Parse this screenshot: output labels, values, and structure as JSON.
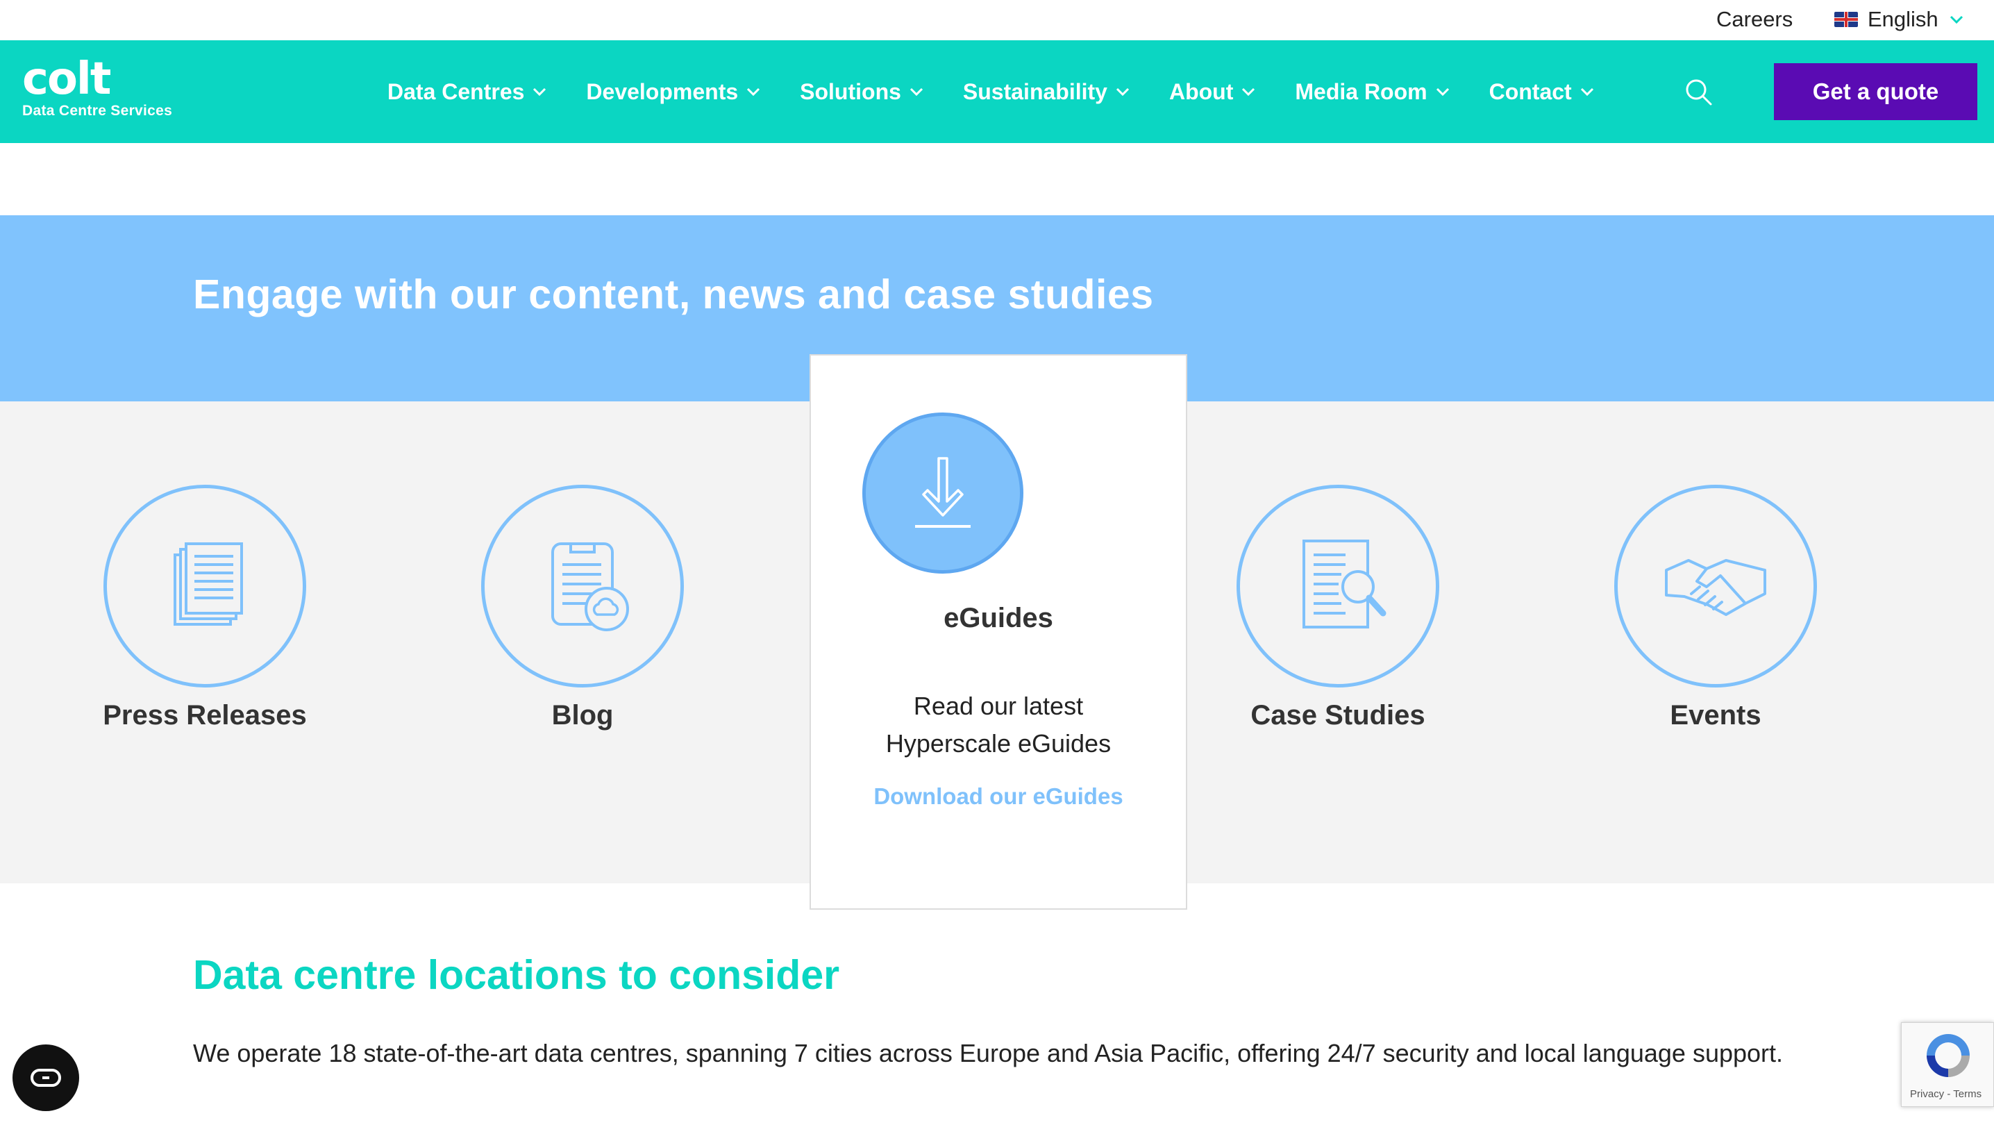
{
  "topbar": {
    "careers": "Careers",
    "language": "English",
    "flag_icon": "uk-flag-icon"
  },
  "brand": {
    "logo_word": "colt",
    "logo_sub": "Data Centre Services",
    "teal": "#0bd6c2",
    "purple": "#5a0bb3",
    "light_blue": "#80c3fd"
  },
  "nav": {
    "items": [
      {
        "label": "Data Centres"
      },
      {
        "label": "Developments"
      },
      {
        "label": "Solutions"
      },
      {
        "label": "Sustainability"
      },
      {
        "label": "About"
      },
      {
        "label": "Media Room"
      },
      {
        "label": "Contact"
      }
    ],
    "quote_label": "Get a quote"
  },
  "banner": {
    "title": "Engage with our content, news and case studies"
  },
  "tiles": [
    {
      "label": "Press Releases",
      "icon": "documents-icon"
    },
    {
      "label": "Blog",
      "icon": "blog-cloud-icon"
    },
    {
      "label": "Case Studies",
      "icon": "document-search-icon"
    },
    {
      "label": "Events",
      "icon": "handshake-icon"
    }
  ],
  "featured": {
    "title": "eGuides",
    "desc_line1": "Read our latest",
    "desc_line2": "Hyperscale eGuides",
    "link": "Download our eGuides",
    "icon": "download-icon"
  },
  "locations": {
    "title": "Data centre locations to consider",
    "text": "We operate 18 state-of-the-art data centres, spanning 7 cities across Europe and Asia Pacific, offering 24/7 security and local language support."
  },
  "recaptcha": {
    "terms": "Privacy - Terms"
  }
}
